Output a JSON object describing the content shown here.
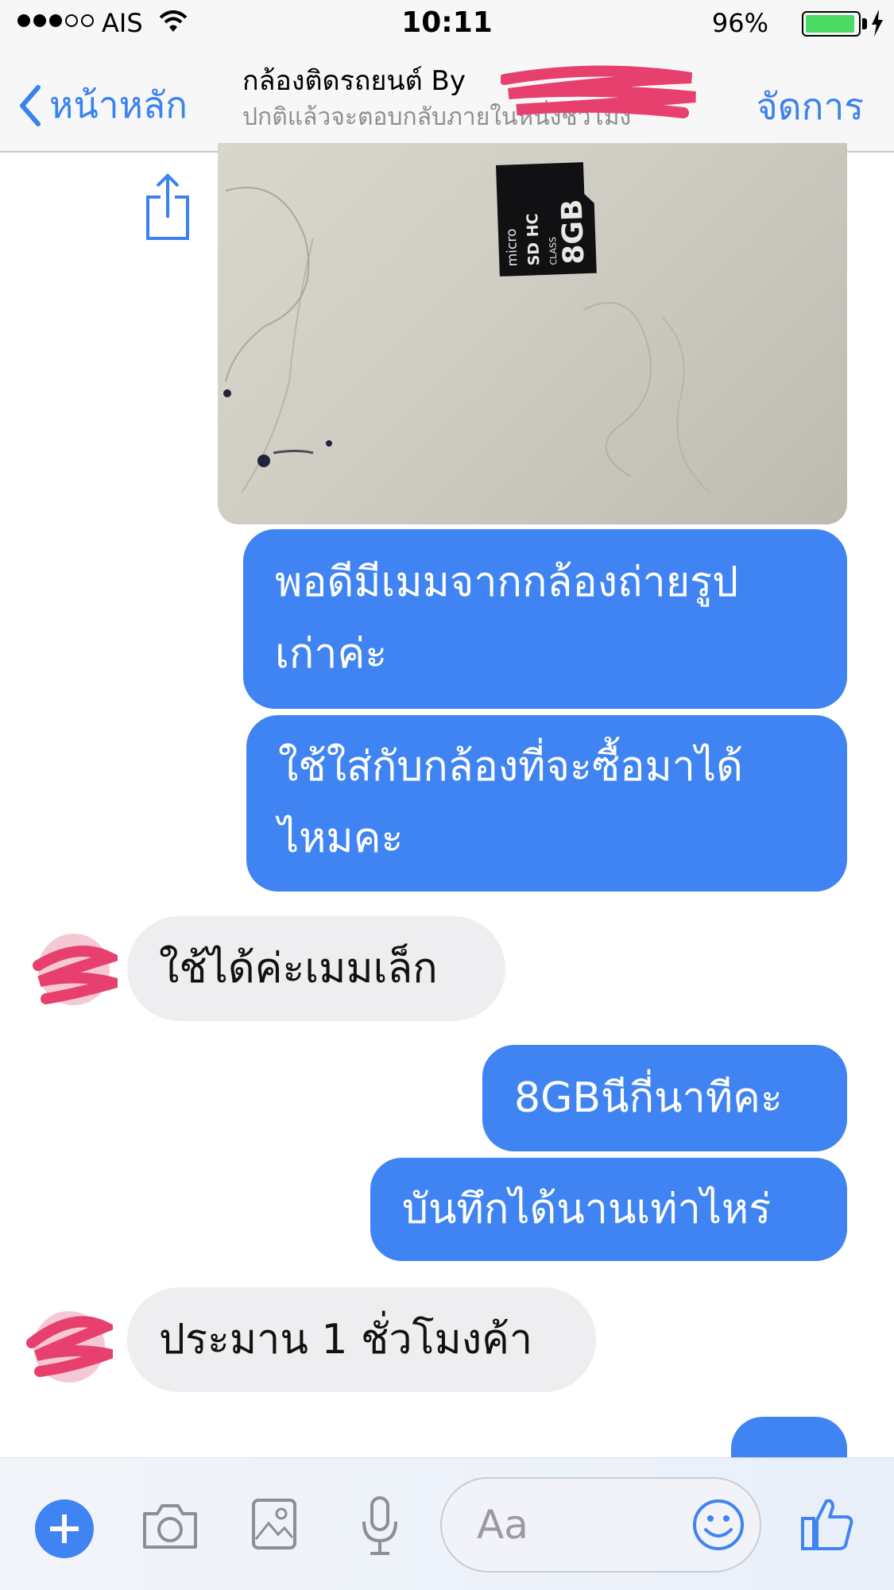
{
  "status_bar": {
    "carrier": "AIS",
    "time": "10:11",
    "battery_percent": "96%",
    "battery_level": 0.96
  },
  "nav": {
    "back_label": "หน้าหลัก",
    "title": "กล้องติดรถยนต์ By",
    "subtitle": "ปกติแล้วจะตอบกลับภายในหนึ่งชั่วโมง",
    "manage_label": "จัดการ"
  },
  "messages": [
    {
      "from": "me",
      "text_lines": [
        "พอดีมีเมมจากกล้องถ่ายรูป",
        "เก่าค่ะ"
      ]
    },
    {
      "from": "me",
      "text_lines": [
        " ใช้ใส่กับกล้องที่จะซื้อมาได้",
        "ไหมคะ"
      ]
    },
    {
      "from": "shop",
      "text": "ใช้ได้ค่ะเมมเล็ก"
    },
    {
      "from": "me",
      "text": "8GBนีกี่นาทีคะ"
    },
    {
      "from": "me",
      "text": "บันทึกได้นานเท่าไหร่"
    },
    {
      "from": "shop",
      "text": "ประมาน 1 ชั่วโมงค้า"
    }
  ],
  "photo": {
    "card_brand": "micro",
    "card_type": "SD HC",
    "card_capacity": "8GB",
    "card_class": "CLASS"
  },
  "composer": {
    "placeholder": "Aa"
  },
  "colors": {
    "accent": "#3f84f2",
    "incoming_bubble": "#eeeef0",
    "redaction": "#e8406e"
  },
  "icons": [
    "share-icon",
    "plus-icon",
    "camera-icon",
    "image-icon",
    "microphone-icon",
    "emoji-icon",
    "thumbs-up-icon",
    "chevron-left-icon",
    "wifi-icon",
    "bolt-icon"
  ]
}
